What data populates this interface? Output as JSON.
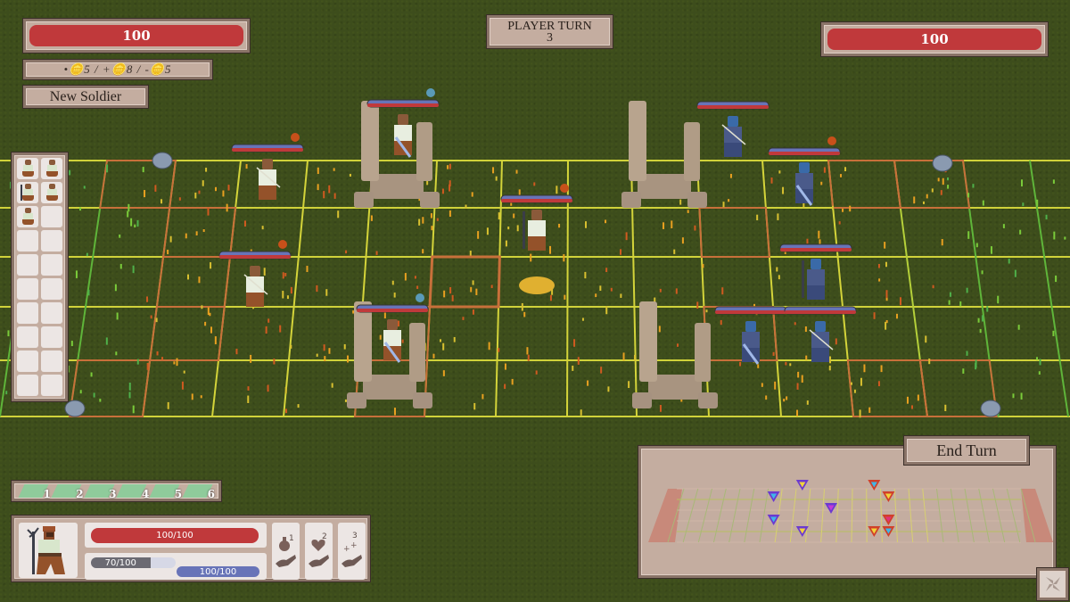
{
  "player_hp": {
    "value": 100,
    "label": "100"
  },
  "enemy_hp": {
    "value": 100,
    "label": "100"
  },
  "resources": {
    "text": "•🪙5  /  +🪙8  /  -🪙5",
    "current": 5,
    "income": 8,
    "upkeep": 5
  },
  "new_soldier_button": "New Soldier",
  "turn": {
    "label": "PLAYER TURN",
    "number": "3"
  },
  "end_turn_button": "End Turn",
  "roster": {
    "slots_total": 20,
    "units": [
      {
        "type": "bowman"
      },
      {
        "type": "swordsman"
      },
      {
        "type": "staff-mage"
      },
      {
        "type": "swordsman"
      },
      {
        "type": "bowman"
      }
    ]
  },
  "hotbar": {
    "slots": [
      "1",
      "2",
      "3",
      "4",
      "5",
      "6"
    ]
  },
  "selected_unit": {
    "type": "staff-mage",
    "health": {
      "label": "100/100",
      "fraction": 1.0
    },
    "stamina": {
      "label": "70/100",
      "fraction": 0.7
    },
    "mana": {
      "label": "100/100",
      "fraction": 1.0
    },
    "abilities": [
      {
        "key": "1",
        "icon": "potion-give-icon"
      },
      {
        "key": "2",
        "icon": "heart-give-icon"
      },
      {
        "key": "3",
        "icon": "sparkle-give-icon"
      }
    ]
  },
  "battlefield": {
    "rows": 5,
    "player_units": [
      {
        "type": "bowman",
        "col": 3,
        "row": 0,
        "status": "fire"
      },
      {
        "type": "swordsman",
        "col": 5,
        "row": -1,
        "status": "water"
      },
      {
        "type": "staff-mage",
        "col": 7,
        "row": 1,
        "status": "fire",
        "selected": true
      },
      {
        "type": "bowman",
        "col": 3,
        "row": 2,
        "status": "fire"
      },
      {
        "type": "swordsman",
        "col": 5,
        "row": 3,
        "status": "water"
      }
    ],
    "enemy_units": [
      {
        "type": "bowman",
        "col": 10,
        "row": -1
      },
      {
        "type": "swordsman",
        "col": 11,
        "row": 0,
        "status": "fire"
      },
      {
        "type": "staff-mage",
        "col": 11,
        "row": 2
      },
      {
        "type": "swordsman",
        "col": 10,
        "row": 3
      },
      {
        "type": "bowman",
        "col": 11,
        "row": 3
      }
    ]
  },
  "minimap": {
    "markers": [
      {
        "side": "player",
        "core": "#f2d43a",
        "col": 8,
        "row": 0
      },
      {
        "side": "player",
        "core": "#3fb6e8",
        "col": 6,
        "row": 1
      },
      {
        "side": "player",
        "core": "#c43ad8",
        "col": 10,
        "row": 2
      },
      {
        "side": "player",
        "core": "#3fb6e8",
        "col": 6,
        "row": 3
      },
      {
        "side": "player",
        "core": "#f2d43a",
        "col": 8,
        "row": 4
      },
      {
        "side": "enemy",
        "core": "#3fb6e8",
        "col": 13,
        "row": 0
      },
      {
        "side": "enemy",
        "core": "#f2d43a",
        "col": 14,
        "row": 1
      },
      {
        "side": "enemy",
        "core": "#e0327a",
        "col": 14,
        "row": 3
      },
      {
        "side": "enemy",
        "core": "#f2d43a",
        "col": 13,
        "row": 4
      },
      {
        "side": "enemy",
        "core": "#3fb6e8",
        "col": 14,
        "row": 4
      }
    ]
  },
  "colors": {
    "hp_red": "#c0393b",
    "mana_blue": "#6874b8",
    "stamina_gray": "#6b6a72",
    "panel": "#c4ada0",
    "player_marker": "#6b3ad0",
    "enemy_marker": "#d0402a"
  }
}
